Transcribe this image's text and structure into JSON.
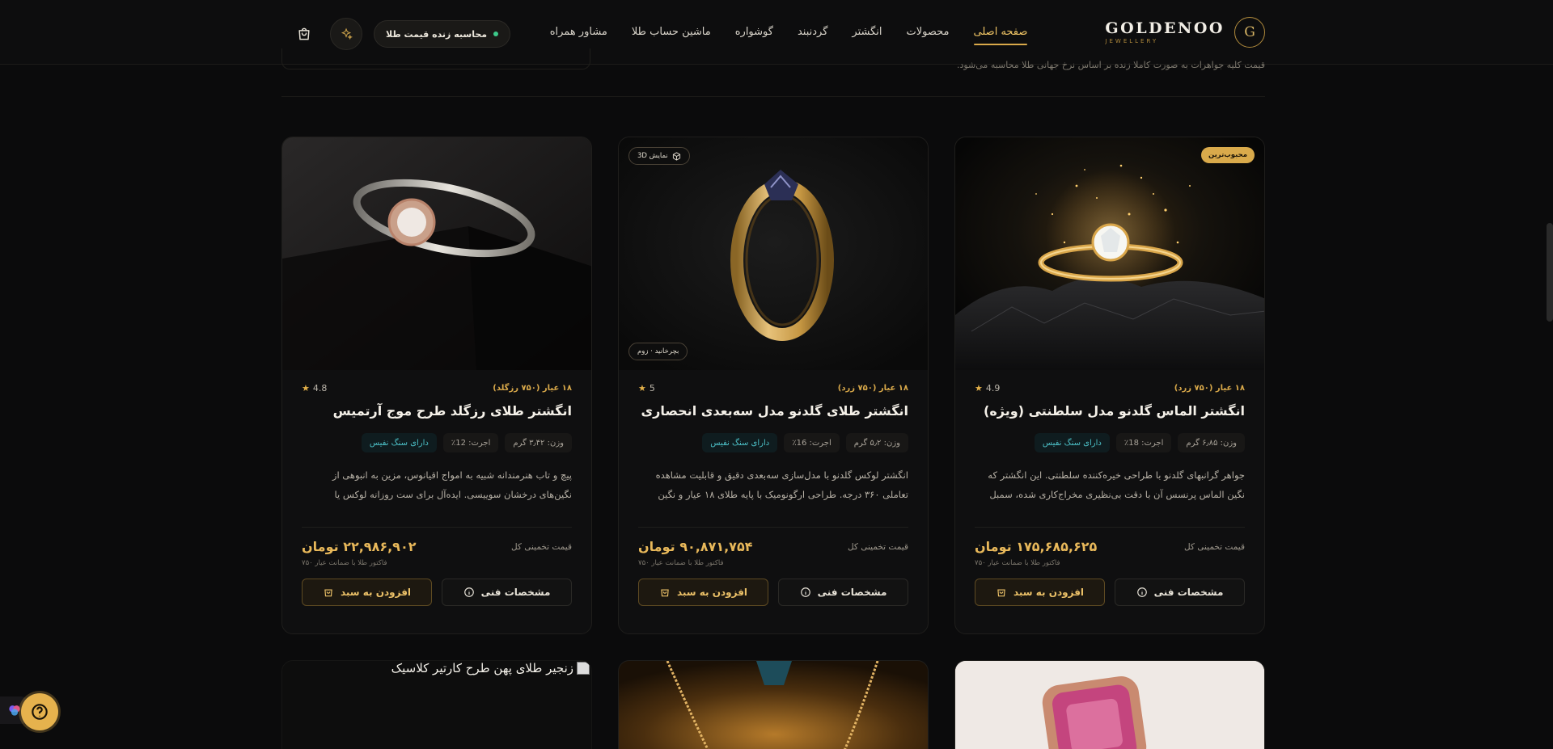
{
  "nav": {
    "brand_initial": "G",
    "brand_name": "GOLDENOO",
    "brand_sub": "JEWELLERY",
    "menu": [
      {
        "label": "صفحه اصلی",
        "active": true
      },
      {
        "label": "محصولات"
      },
      {
        "label": "انگشتر"
      },
      {
        "label": "گردنبند"
      },
      {
        "label": "گوشواره"
      },
      {
        "label": "ماشین حساب طلا"
      },
      {
        "label": "مشاور همراه"
      }
    ],
    "calc_label": "محاسبه زنده قیمت طلا",
    "icons": [
      "cart-icon",
      "sparkle-icon"
    ]
  },
  "top_strip": {
    "text": "قیمت کلیه جواهرات به صورت کاملا زنده بر اساس نرخ جهانی طلا محاسبه می‌شود."
  },
  "products": [
    {
      "badge": "محبوب‌ترین",
      "karat": "۱۸ عیار (۷۵۰ زرد)",
      "rating": "4.9",
      "title": "انگشتر الماس گلدنو مدل سلطنتی (ویژه)",
      "chips": [
        "وزن: ۶٫۸۵ گرم",
        "اجرت: 18٪",
        "دارای سنگ نفیس"
      ],
      "description": "جواهر گرانبهای گلدنو با طراحی خیره‌کننده سلطنتی. این انگشتر که نگین الماس پرنسس آن با دقت بی‌نظیری مخراج‌کاری شده، سمبل شکوه و...",
      "price_label": "قیمت تخمینی کل",
      "price": "۱۷۵,۶۸۵,۶۲۵ تومان",
      "price_note": "فاکتور طلا با ضمانت عیار ۷۵۰",
      "spec_label": "مشخصات فنی",
      "cart_label": "افزودن به سبد"
    },
    {
      "badge_3d": "نمایش 3D",
      "badge_zoom": "بچرخانید · زوم",
      "karat": "۱۸ عیار (۷۵۰ زرد)",
      "rating": "5",
      "title": "انگشتر طلای گلدنو مدل سه‌بعدی انحصاری",
      "chips": [
        "وزن: ۵٫۲ گرم",
        "اجرت: 16٪",
        "دارای سنگ نفیس"
      ],
      "description": "انگشتر لوکس گلدنو با مدل‌سازی سه‌بعدی دقیق و قابلیت مشاهده تعاملی ۳۶۰ درجه. طراحی ارگونومیک با پایه طلای ۱۸ عیار و نگین برلیان...",
      "price_label": "قیمت تخمینی کل",
      "price": "۹۰,۸۷۱,۷۵۴ تومان",
      "price_note": "فاکتور طلا با ضمانت عیار ۷۵۰",
      "spec_label": "مشخصات فنی",
      "cart_label": "افزودن به سبد"
    },
    {
      "karat": "۱۸ عیار (۷۵۰ رزگلد)",
      "rating": "4.8",
      "title": "انگشتر طلای رزگلد طرح موج آرتمیس",
      "chips": [
        "وزن: ۳٫۴۲ گرم",
        "اجرت: 12٪",
        "دارای سنگ نفیس"
      ],
      "description": "پیچ و تاب هنرمندانه شبیه به امواج اقیانوس، مزین به انبوهی از نگین‌های درخشان سوییسی. ایده‌آل برای ست روزانه لوکس یا هدیه‌ای...",
      "price_label": "قیمت تخمینی کل",
      "price": "۲۲,۹۸۶,۹۰۲ تومان",
      "price_note": "فاکتور طلا با ضمانت عیار ۷۵۰",
      "spec_label": "مشخصات فنی",
      "cart_label": "افزودن به سبد"
    }
  ],
  "next_row": {
    "broken_image_alt": "زنجیر طلای پهن طرح کارتیر کلاسیک"
  },
  "colors": {
    "gold": "#e8b85a",
    "background": "#0b0b0c",
    "accent_teal": "#4cc0c7"
  }
}
